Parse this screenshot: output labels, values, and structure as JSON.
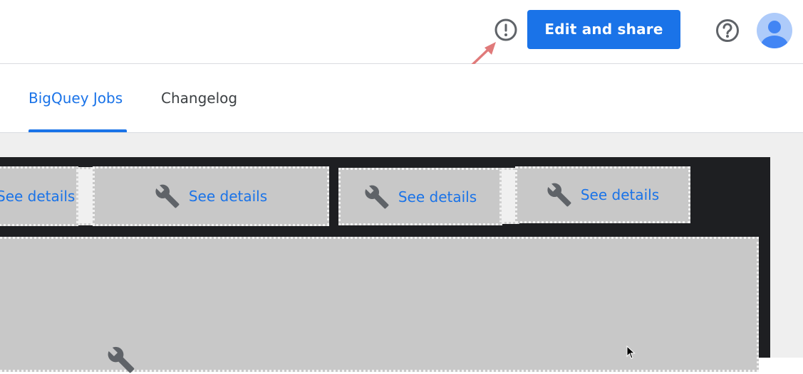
{
  "header": {
    "edit_share_label": "Edit and share",
    "icons": [
      "alert-circle-icon",
      "help-circle-icon",
      "account-avatar-icon"
    ]
  },
  "tabs": [
    {
      "label": "BigQuey Jobs",
      "active": true
    },
    {
      "label": "Changelog",
      "active": false
    }
  ],
  "cards": {
    "card1_label": "See details",
    "card2_label": "See details",
    "card3_label": "See details",
    "card4_label": "See details"
  },
  "colors": {
    "accent": "#1a73e8",
    "annotation_arrow": "#e07a7a",
    "dark_panel": "#1e1f22",
    "card_fill": "#c8c8c8"
  }
}
